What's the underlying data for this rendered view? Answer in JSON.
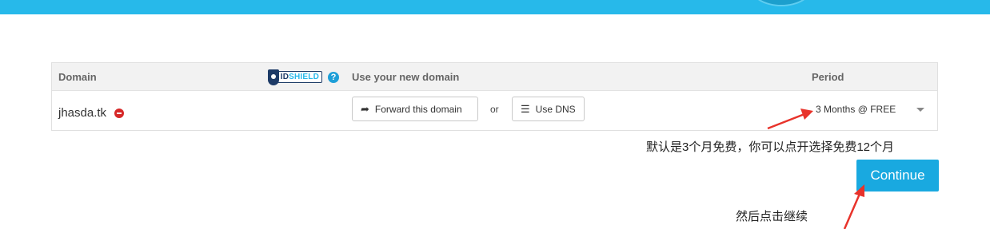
{
  "header": {
    "accent_color": "#27b9ea"
  },
  "table": {
    "columns": {
      "domain": "Domain",
      "use_new": "Use your new domain",
      "period": "Period"
    },
    "idshield": {
      "prefix": "ID",
      "suffix": "SHIELD"
    },
    "help_glyph": "?",
    "row": {
      "domain_name": "jhasda.tk",
      "forward_label": "Forward this domain",
      "forward_icon": "share-arrow-icon",
      "or_label": "or",
      "dns_label": "Use DNS",
      "dns_icon": "list-icon",
      "period_value": "3 Months @ FREE"
    }
  },
  "annotations": {
    "note_period": "默认是3个月免费，你可以点开选择免费12个月",
    "note_continue": "然后点击继续",
    "arrow_color": "#e8332b"
  },
  "actions": {
    "continue_label": "Continue",
    "continue_color": "#19a9e0"
  }
}
